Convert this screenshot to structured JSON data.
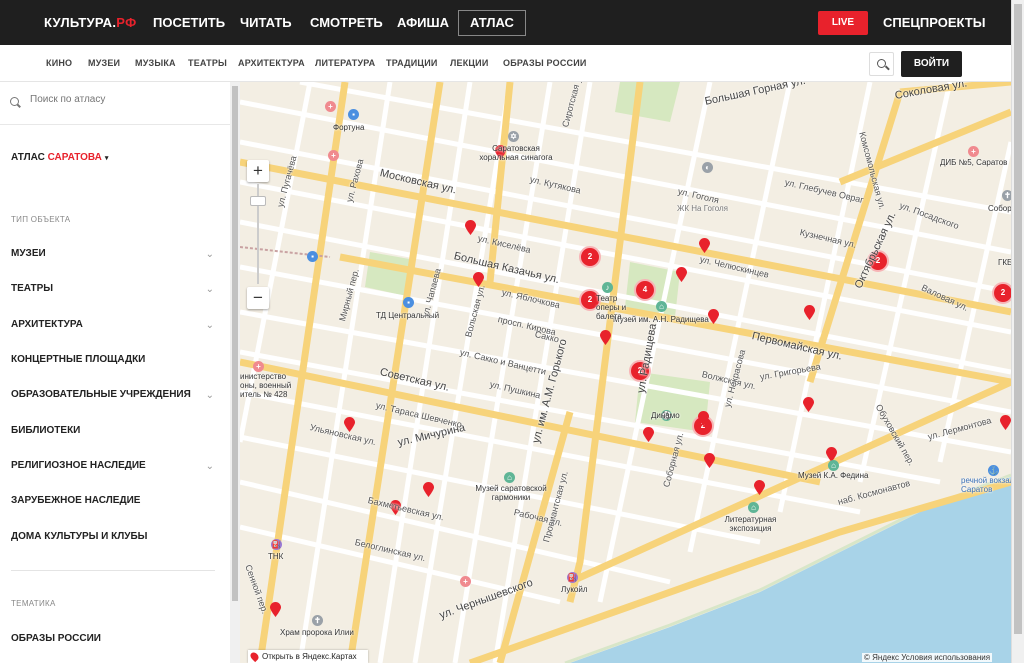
{
  "header": {
    "logo_main": "КУЛЬТУРА.",
    "logo_rf": "РФ",
    "nav": [
      "ПОСЕТИТЬ",
      "ЧИТАТЬ",
      "СМОТРЕТЬ",
      "АФИША"
    ],
    "atlas": "АТЛАС",
    "live": "LIVE",
    "special": "СПЕЦПРОЕКТЫ"
  },
  "subnav": {
    "categories": [
      "КИНО",
      "МУЗЕИ",
      "МУЗЫКА",
      "ТЕАТРЫ",
      "АРХИТЕКТУРА",
      "ЛИТЕРАТУРА",
      "ТРАДИЦИИ",
      "ЛЕКЦИИ",
      "ОБРАЗЫ РОССИИ"
    ],
    "login": "ВОЙТИ",
    "search_icon": "search-icon"
  },
  "sidebar": {
    "search_placeholder": "Поиск по атласу",
    "title_prefix": "АТЛАС",
    "title_city": "САРАТОВА",
    "title_caret": "▾",
    "object_type_heading": "ТИП ОБЪЕКТА",
    "items": [
      {
        "label": "МУЗЕИ",
        "chevron": "⌄"
      },
      {
        "label": "ТЕАТРЫ",
        "chevron": "⌄"
      },
      {
        "label": "АРХИТЕКТУРА",
        "chevron": "⌄"
      },
      {
        "label": "КОНЦЕРТНЫЕ ПЛОЩАДКИ",
        "chevron": ""
      },
      {
        "label": "ОБРАЗОВАТЕЛЬНЫЕ УЧРЕЖДЕНИЯ",
        "chevron": "⌄"
      },
      {
        "label": "БИБЛИОТЕКИ",
        "chevron": ""
      },
      {
        "label": "РЕЛИГИОЗНОЕ НАСЛЕДИЕ",
        "chevron": "⌄"
      },
      {
        "label": "ЗАРУБЕЖНОЕ НАСЛЕДИЕ",
        "chevron": ""
      },
      {
        "label": "ДОМА КУЛЬТУРЫ И КЛУБЫ",
        "chevron": ""
      }
    ],
    "theme_heading": "ТЕМАТИКА",
    "theme_items": [
      "ОБРАЗЫ РОССИИ"
    ]
  },
  "map": {
    "zoom_in": "+",
    "zoom_out": "−",
    "open_yandex": "Открыть в Яндекс.Картах",
    "copyright": "© Яндекс Условия использования",
    "clusters": [
      "2",
      "2",
      "4",
      "2",
      "2",
      "2",
      "2"
    ],
    "streets": [
      "Большая Горная ул.",
      "Соколовая ул.",
      "ул. Рахова",
      "Московская ул.",
      "ул. Кутякова",
      "ул. Киселёва",
      "Большая Казачья ул.",
      "ул. Яблочкова",
      "просп. Кирова",
      "Первомайская ул.",
      "ул. Чапаева",
      "Вольская ул.",
      "ул. им. А.М. Горького",
      "Советская ул.",
      "ул. Мичурина",
      "Рабочая ул.",
      "ул. Чернышевского",
      "ул. Пушкина",
      "ул. Челюскинцев",
      "Октябрьская ул.",
      "Волжская ул.",
      "Соборная ул.",
      "ул. Радищева",
      "ул. Григорьева",
      "наб. Космонавтов",
      "Ульяновская ул.",
      "Бахметьевская ул.",
      "Белоглинская ул.",
      "ул. Тараса Шевченко",
      "ул. Сакко и Ванцетти",
      "ул. Гоголя",
      "ул. Лермонтова",
      "Сенной пер.",
      "ул. Пугачёва",
      "Кузнечная ул.",
      "Валовая ул.",
      "Мирный пер.",
      "ул. Некрасова",
      "Обуховский пер.",
      "Комсомольская ул.",
      "ул. Посадского",
      "Сиротская ул.",
      "ул. Глебучев Овраг",
      "Провиантская ул.",
      "Сакко"
    ],
    "labels": [
      "Фортуна",
      "Саратовская хоральная синагога",
      "ЖК На Гоголя",
      "ДИБ №5, Саратов",
      "Собор Свято",
      "ГКБ",
      "ТД Центральный",
      "Музей им. А.Н. Радищева",
      "Театр оперы и балета",
      "Динамо",
      "инистерство оны, военный итель № 428",
      "Музей саратовской гармоники",
      "Музей К.А. Федина",
      "Литературная экспозиция",
      "речной вокзал Саратов",
      "ТНК",
      "Лукойл",
      "Храм пророка Илии"
    ]
  }
}
